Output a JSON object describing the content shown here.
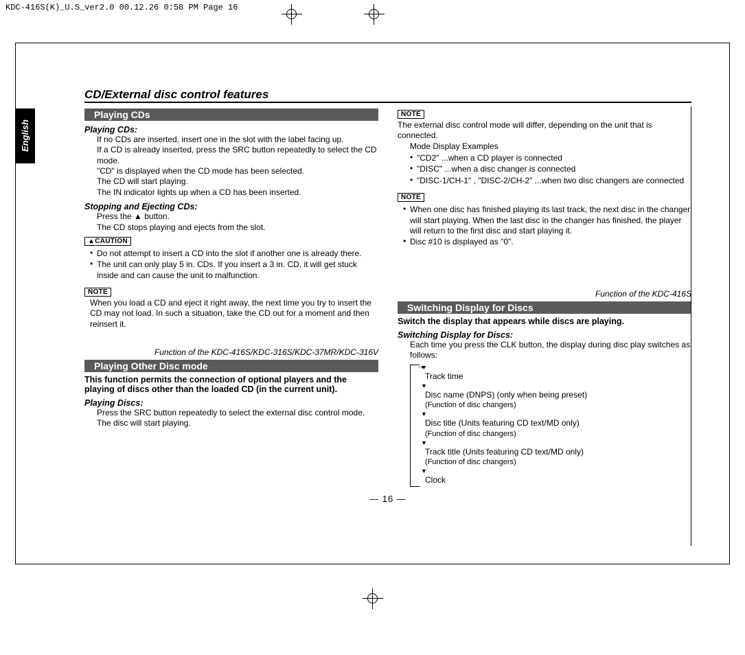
{
  "header": {
    "stamp": "KDC-416S(K)_U.S_ver2.0  00.12.26 0:58 PM  Page 16"
  },
  "side_tab": "English",
  "title": "CD/External disc control features",
  "page_number": "— 16 —",
  "left": {
    "sec1": {
      "bar": "Playing CDs",
      "h1": "Playing CDs:",
      "p1": "If no CDs are inserted, insert one in the slot with the label facing up.",
      "p2": "If a CD is already inserted, press the SRC button repeatedly to select the CD mode.",
      "p3": "\"CD\" is displayed when the CD mode has been selected.",
      "p4": "The CD will start playing.",
      "p5": "The IN indicator lights up when a CD has been inserted.",
      "h2": "Stopping and Ejecting CDs:",
      "p6": "Press the ▲ button.",
      "p7": "The CD stops playing and ejects from the slot.",
      "caution_label": "▲CAUTION",
      "c1": "Do not attempt to insert a CD into the slot if another one is already there.",
      "c2": "The unit can only play 5 in. CDs. If you insert a 3 in. CD, it will get stuck inside and can cause the unit to malfunction.",
      "note_label": "NOTE",
      "n1": "When you load a CD and eject it right away, the next time you try to insert the CD may not load. In such a situation, take the CD out for a moment and then reinsert it."
    },
    "sec2": {
      "func": "Function of the KDC-416S/KDC-316S/KDC-37MR/KDC-316V",
      "bar": "Playing Other Disc mode",
      "lead": "This function permits the connection of optional players and the playing of discs other than the loaded CD (in the current unit).",
      "h1": "Playing Discs:",
      "p1": "Press the SRC button repeatedly to select the external disc control mode.",
      "p2": "The disc will start playing."
    }
  },
  "right": {
    "note1_label": "NOTE",
    "n1a": "The external disc control mode will differ, depending on the unit that is connected.",
    "n1b": "Mode Display Examples",
    "n1_list": [
      "\"CD2\" ...when a CD player is connected",
      "\"DISC\" ...when a disc changer is connected",
      "\"DISC-1/CH-1\" , \"DISC-2/CH-2\" ...when two disc changers are connected"
    ],
    "note2_label": "NOTE",
    "n2_list": [
      "When one disc has finished playing its last track, the next disc in the changer will start playing. When the last disc in the changer has finished, the player will return to the first disc and start playing it.",
      "Disc #10 is displayed as \"0\"."
    ],
    "sec3": {
      "func": "Function of the KDC-416S",
      "bar": "Switching Display for Discs",
      "lead": "Switch the display that appears while discs are playing.",
      "h1": "Switching Display for Discs:",
      "p1": "Each time you press the CLK button, the display during disc play switches as follows:",
      "flow": [
        {
          "main": "Track time",
          "sub": ""
        },
        {
          "main": "Disc name (DNPS) (only when being preset)",
          "sub": "(Function of disc changers)"
        },
        {
          "main": "Disc title (Units featuring CD text/MD only)",
          "sub": "(Function of disc changers)"
        },
        {
          "main": "Track title (Units featuring CD text/MD only)",
          "sub": "(Function of disc changers)"
        },
        {
          "main": "Clock",
          "sub": ""
        }
      ]
    }
  }
}
